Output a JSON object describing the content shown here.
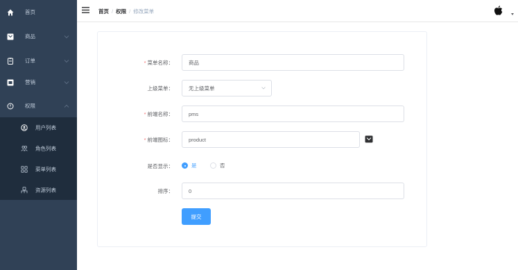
{
  "sidebar": {
    "items": [
      {
        "label": "首页",
        "icon": "home-icon",
        "expanded": null
      },
      {
        "label": "商品",
        "icon": "goods-icon",
        "expanded": false
      },
      {
        "label": "订单",
        "icon": "order-icon",
        "expanded": false
      },
      {
        "label": "营销",
        "icon": "marketing-icon",
        "expanded": false
      },
      {
        "label": "权限",
        "icon": "shield-icon",
        "expanded": true
      }
    ],
    "sub_items": [
      {
        "label": "用户列表",
        "icon": "user-icon"
      },
      {
        "label": "角色列表",
        "icon": "role-icon"
      },
      {
        "label": "菜单列表",
        "icon": "menu-grid-icon"
      },
      {
        "label": "资源列表",
        "icon": "resource-icon"
      }
    ]
  },
  "header": {
    "breadcrumb": [
      "首页",
      "权限",
      "修改菜单"
    ],
    "breadcrumb_sep": "/",
    "avatar_icon": "apple-icon"
  },
  "form": {
    "title_label": "菜单名称：",
    "title_value": "商品",
    "parent_label": "上级菜单：",
    "parent_value": "无上级菜单",
    "frontend_name_label": "前端名称：",
    "frontend_name_value": "pms",
    "frontend_icon_label": "前端图标：",
    "frontend_icon_value": "product",
    "visible_label": "是否显示：",
    "visible_options": [
      "是",
      "否"
    ],
    "visible_selected": "是",
    "sort_label": "排序：",
    "sort_value": "0",
    "submit_label": "提交",
    "required_mark": "*"
  },
  "colors": {
    "sidebar_bg": "#304156",
    "submenu_bg": "#1f2d3d",
    "primary": "#409eff",
    "required": "#f56c6c"
  }
}
